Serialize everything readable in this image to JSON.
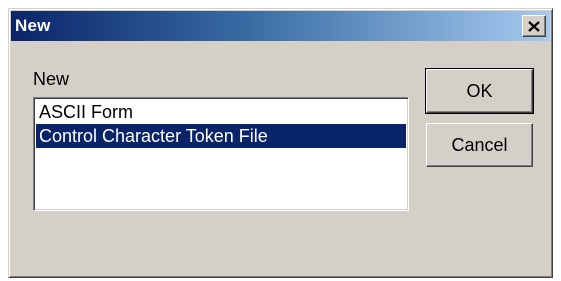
{
  "window": {
    "title": "New",
    "close_icon": "close-icon"
  },
  "content": {
    "label": "New",
    "list": {
      "items": [
        {
          "label": "ASCII Form",
          "selected": false
        },
        {
          "label": "Control Character Token File",
          "selected": true
        }
      ]
    }
  },
  "buttons": {
    "ok_label": "OK",
    "cancel_label": "Cancel"
  },
  "colors": {
    "face": "#d4d0c8",
    "titlebar_start": "#0a246a",
    "titlebar_end": "#a6caf0",
    "selection": "#0a246a"
  }
}
